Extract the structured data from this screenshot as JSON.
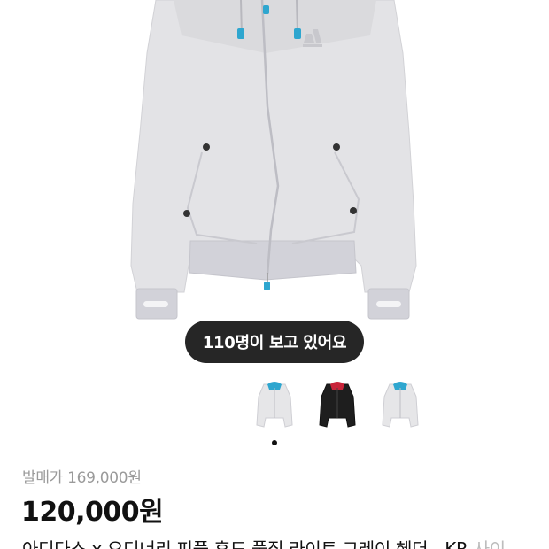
{
  "product": {
    "viewers_text": "110명이 보고 있어요",
    "original_price": "발매가 169,000원",
    "sale_price": "120,000원",
    "title": "아디다스 x 오디너리 피플 후드 풀집 라이트 그레이 헤더 - KR",
    "title_tail": " 사이"
  },
  "thumbnails": [
    {
      "label": "light grey hoodie",
      "color": "#e6e6e8",
      "accent": "#2ea6cf"
    },
    {
      "label": "black hoodie",
      "color": "#1e1e1e",
      "accent": "#c8243a"
    },
    {
      "label": "light grey hoodie alt",
      "color": "#e6e6e8",
      "accent": "#2ea6cf"
    }
  ],
  "colors": {
    "badge_bg": "#262626",
    "hoodie": "#dedee1",
    "rib": "#cfcfd6",
    "accent": "#2ea6cf"
  },
  "icons": [
    "adidas-logo-icon",
    "carousel-dot-icon"
  ]
}
